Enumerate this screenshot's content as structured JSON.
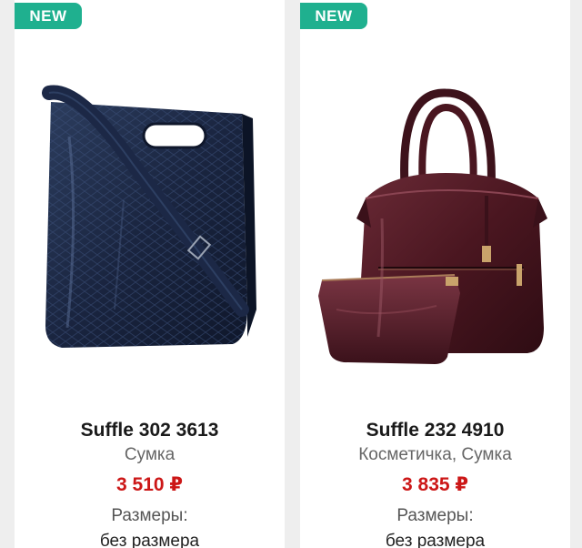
{
  "products": [
    {
      "badge": "NEW",
      "name": "Suffle 302 3613",
      "category": "Сумка",
      "price": "3 510 ₽",
      "sizes_label": "Размеры:",
      "sizes_value": "без размера",
      "image": "navy-croc-tote-bag-photo"
    },
    {
      "badge": "NEW",
      "name": "Suffle 232 4910",
      "category": "Косметичка, Сумка",
      "price": "3 835 ₽",
      "sizes_label": "Размеры:",
      "sizes_value": "без размера",
      "image": "burgundy-handbag-with-pouch-photo"
    }
  ],
  "colors": {
    "badge": "#1fb08f",
    "price": "#cc1717",
    "card_bg": "#ffffff",
    "page_bg": "#eeeeee"
  }
}
